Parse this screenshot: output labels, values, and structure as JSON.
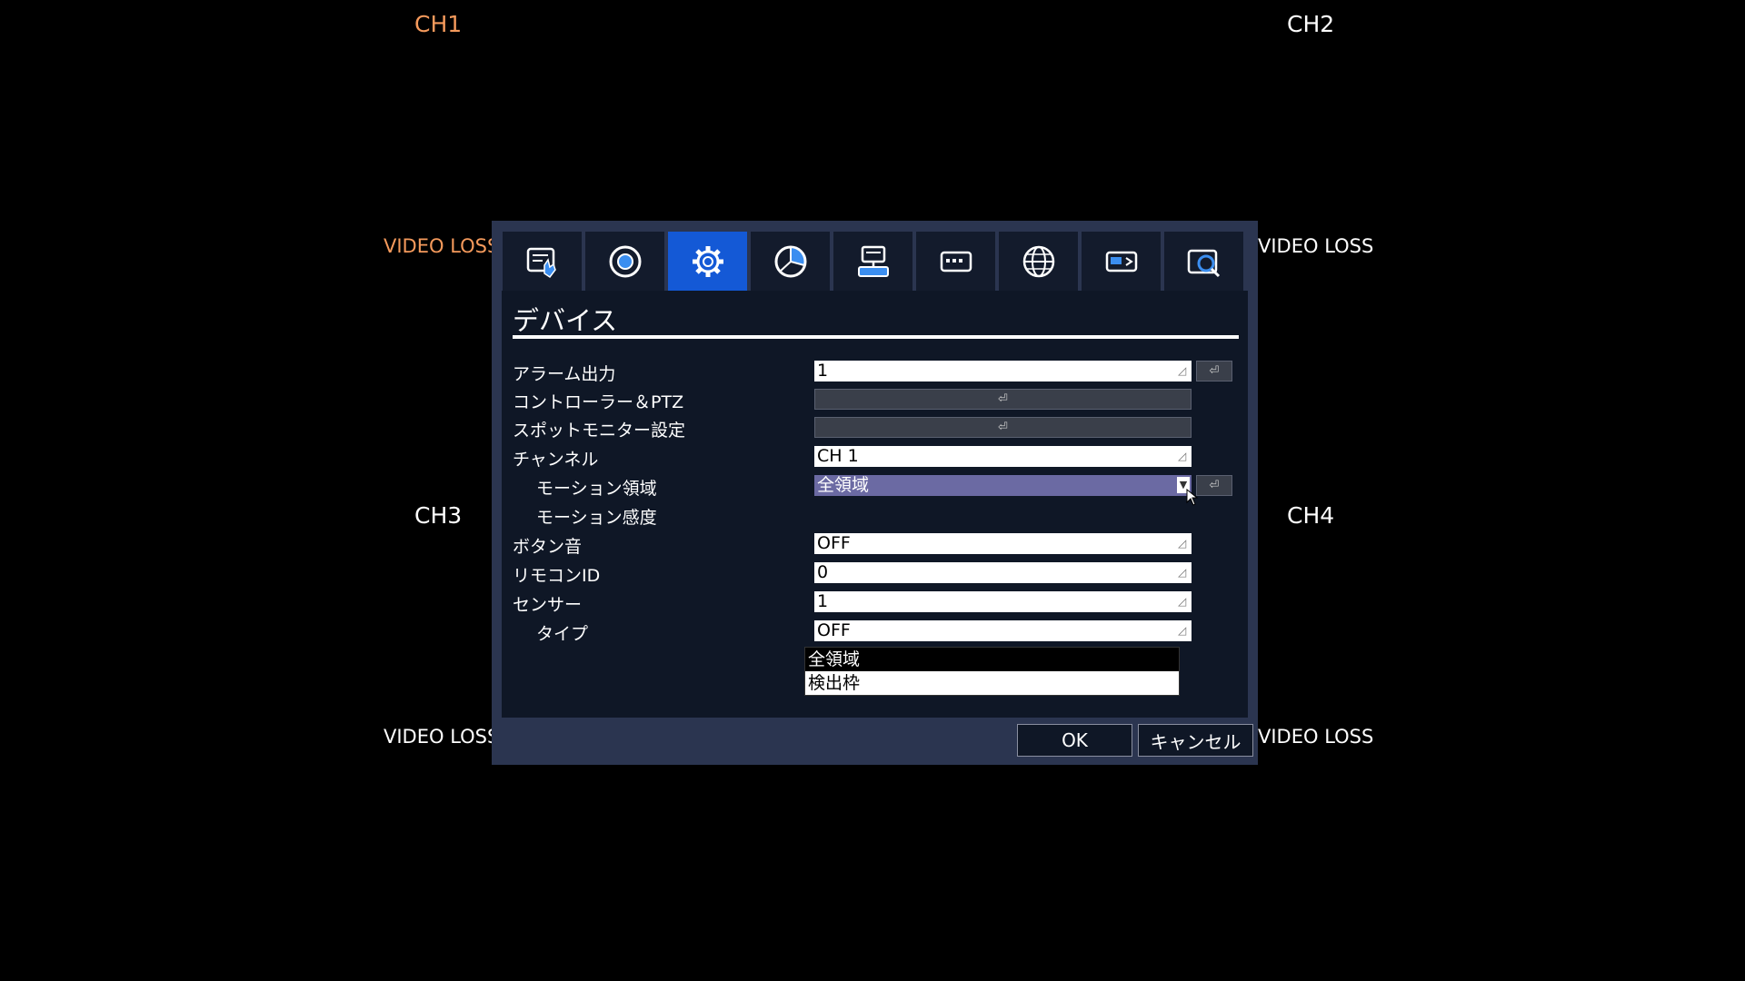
{
  "channels": {
    "ch1": {
      "label": "CH1",
      "status": "VIDEO LOSS"
    },
    "ch2": {
      "label": "CH2",
      "status": "VIDEO LOSS"
    },
    "ch3": {
      "label": "CH3",
      "status": "VIDEO LOSS"
    },
    "ch4": {
      "label": "CH4",
      "status": "VIDEO LOSS"
    }
  },
  "tabs": [
    {
      "icon": "hand-config-icon",
      "active": false
    },
    {
      "icon": "record-icon",
      "active": false
    },
    {
      "icon": "gear-icon",
      "active": true
    },
    {
      "icon": "pie-chart-icon",
      "active": false
    },
    {
      "icon": "network-device-icon",
      "active": false
    },
    {
      "icon": "keyboard-icon",
      "active": false
    },
    {
      "icon": "globe-icon",
      "active": false
    },
    {
      "icon": "storage-icon",
      "active": false
    },
    {
      "icon": "search-camera-icon",
      "active": false
    }
  ],
  "section": {
    "title": "デバイス"
  },
  "rows": {
    "alarm_output": {
      "label": "アラーム出力",
      "value": "1"
    },
    "controller_ptz": {
      "label": "コントローラー＆PTZ"
    },
    "spot_monitor": {
      "label": "スポットモニター設定"
    },
    "channel": {
      "label": "チャンネル",
      "value": "CH 1"
    },
    "motion_area": {
      "label": "モーション領域",
      "value": "全領域"
    },
    "motion_sensitivity": {
      "label": "モーション感度"
    },
    "button_sound": {
      "label": "ボタン音",
      "value": "OFF"
    },
    "remote_id": {
      "label": "リモコンID",
      "value": "0"
    },
    "sensor": {
      "label": "センサー",
      "value": "1"
    },
    "type": {
      "label": "タイプ",
      "value": "OFF"
    }
  },
  "dropdown": {
    "options": [
      "全領域",
      "検出枠"
    ],
    "highlighted": 0
  },
  "buttons": {
    "ok": "OK",
    "cancel": "キャンセル"
  },
  "colors": {
    "accent": "#1459d6",
    "channel_orange": "#f59a5c",
    "dialog_bg": "#2b3550",
    "panel_bg": "#0f1726"
  }
}
